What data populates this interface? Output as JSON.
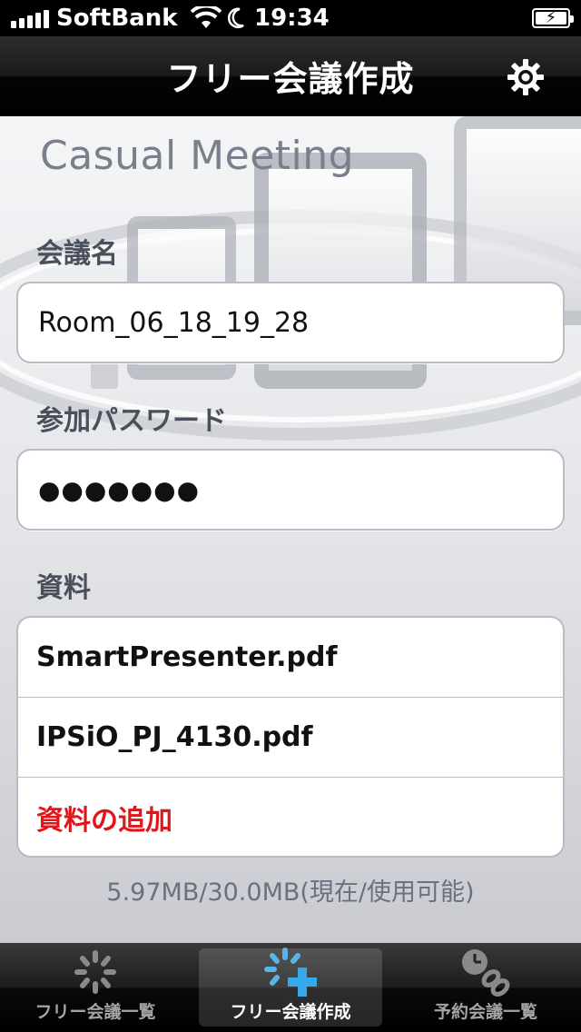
{
  "status_bar": {
    "carrier": "SoftBank",
    "time": "19:34"
  },
  "nav": {
    "title": "フリー会議作成",
    "settings_icon": "gear-icon"
  },
  "brand": {
    "logo_text": "Casual Meeting"
  },
  "form": {
    "meeting_name_label": "会議名",
    "meeting_name_value": "Room_06_18_19_28",
    "password_label": "参加パスワード",
    "password_value": "●●●●●●●",
    "materials_label": "資料",
    "files": [
      "SmartPresenter.pdf",
      "IPSiO_PJ_4130.pdf"
    ],
    "add_material_label": "資料の追加",
    "add_material_color": "#e0161a"
  },
  "storage": {
    "text": "5.97MB/30.0MB(現在/使用可能)"
  },
  "tab_bar": {
    "tabs": [
      {
        "label": "フリー会議一覧",
        "icon": "spinner-icon",
        "active": false
      },
      {
        "label": "フリー会議作成",
        "icon": "spinner-plus-icon",
        "active": true
      },
      {
        "label": "予約会議一覧",
        "icon": "clock-link-icon",
        "active": false
      }
    ]
  }
}
